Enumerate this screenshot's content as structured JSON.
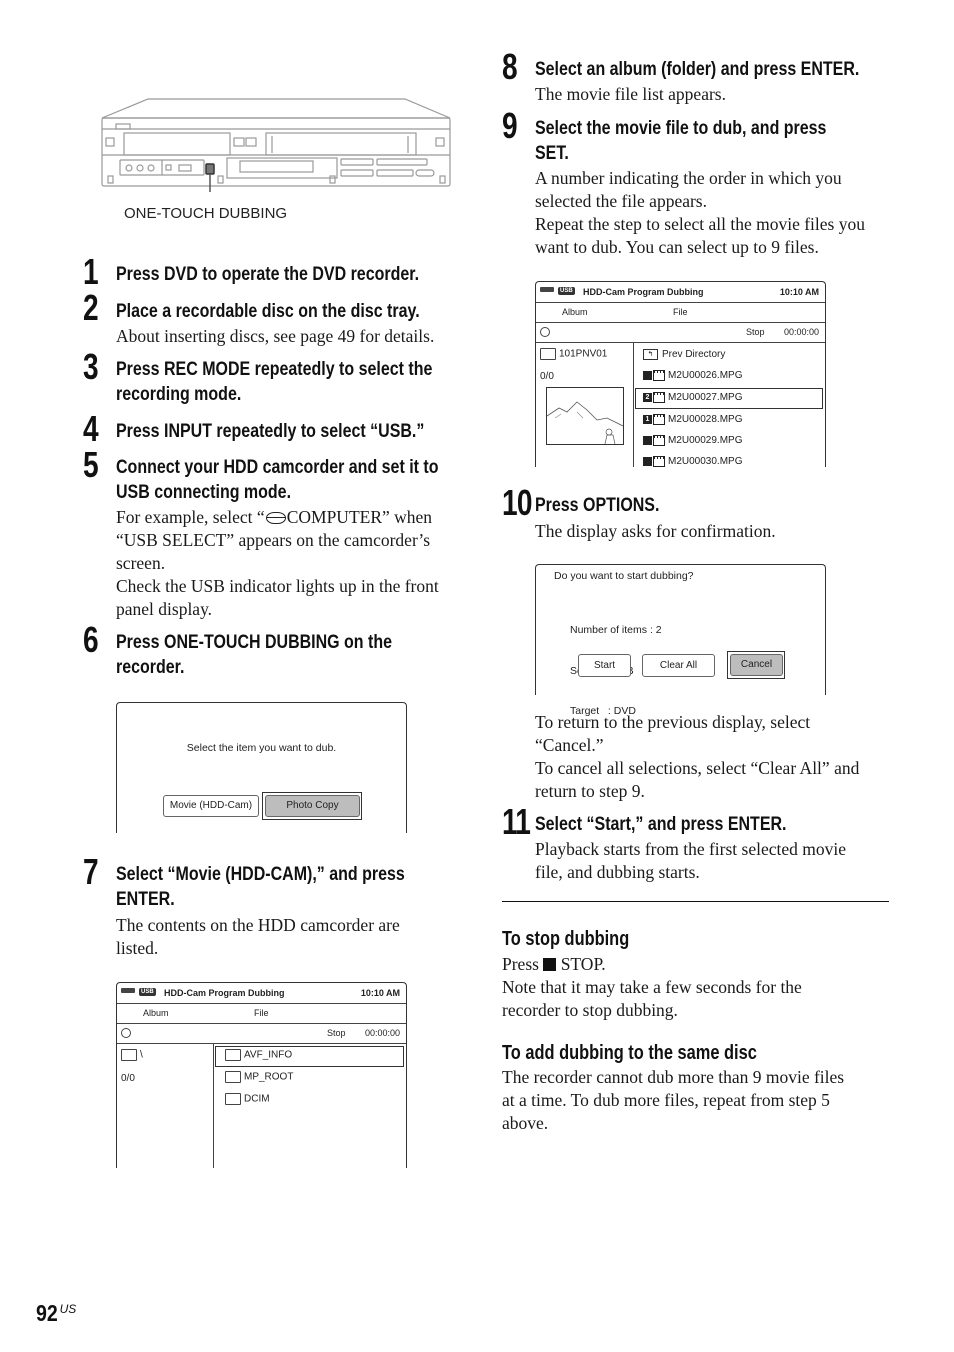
{
  "figure": {
    "callout_label": "ONE-TOUCH DUBBING"
  },
  "steps": [
    {
      "num": "1",
      "heading": [
        "Press DVD to operate the DVD recorder."
      ],
      "body": []
    },
    {
      "num": "2",
      "heading": [
        "Place a recordable disc on the disc tray."
      ],
      "body": [
        "About inserting discs, see page 49 for details."
      ]
    },
    {
      "num": "3",
      "heading": [
        "Press REC MODE repeatedly to select the",
        "recording mode."
      ],
      "body": []
    },
    {
      "num": "4",
      "heading": [
        "Press INPUT repeatedly to select “USB.”"
      ],
      "body": []
    },
    {
      "num": "5",
      "heading": [
        "Connect your HDD camcorder and set it to",
        "USB connecting mode."
      ],
      "body": [
        "For example, select “",
        "COMPUTER” when",
        "“USB SELECT” appears on the camcorder’s",
        "screen.",
        "Check the USB indicator lights up in the front",
        "panel display."
      ]
    },
    {
      "num": "6",
      "heading": [
        "Press ONE-TOUCH DUBBING on the",
        "recorder."
      ],
      "body": []
    },
    {
      "num": "7",
      "heading": [
        "Select “Movie (HDD-CAM),” and press",
        "ENTER."
      ],
      "body": [
        "The contents on the HDD camcorder are",
        "listed."
      ]
    },
    {
      "num": "8",
      "heading": [
        "Select an album (folder) and press ENTER."
      ],
      "body": [
        "The movie file list appears."
      ]
    },
    {
      "num": "9",
      "heading": [
        "Select the movie file to dub, and press",
        "SET."
      ],
      "body": [
        "A number indicating the order in which you",
        "selected the file appears.",
        "Repeat the step to select all the movie files you",
        "want to dub. You can select up to 9 files."
      ]
    },
    {
      "num": "10",
      "heading": [
        "Press OPTIONS."
      ],
      "body": [
        "The display asks for confirmation."
      ]
    },
    {
      "num": "",
      "heading": [],
      "body": [
        "To return to the previous display, select",
        "“Cancel.”",
        "To cancel all selections, select “Clear All” and",
        "return to step 9."
      ]
    },
    {
      "num": "11",
      "heading": [
        "Select “Start,” and press ENTER."
      ],
      "body": [
        "Playback starts from the first selected movie",
        "file, and dubbing starts."
      ]
    }
  ],
  "screen_select": {
    "prompt": "Select the item you want to dub.",
    "buttons": [
      "Movie (HDD-Cam)",
      "Photo Copy"
    ],
    "selected": "Photo Copy"
  },
  "screen_list1": {
    "usb_badge": "USB",
    "title": "HDD-Cam Program Dubbing",
    "time": "10:10 AM",
    "col_album": "Album",
    "col_file": "File",
    "status": "Stop",
    "counter": "00:00:00",
    "album_name": "\\",
    "album_count": "0/0",
    "files": [
      "AVF_INFO",
      "MP_ROOT",
      "DCIM"
    ],
    "selected_index": 0
  },
  "screen_list2": {
    "usb_badge": "USB",
    "title": "HDD-Cam Program Dubbing",
    "time": "10:10 AM",
    "col_album": "Album",
    "col_file": "File",
    "status": "Stop",
    "counter": "00:00:00",
    "album_name": "101PNV01",
    "album_count": "0/0",
    "prev_dir": "Prev Directory",
    "files": [
      {
        "name": "M2U00026.MPG",
        "order": ""
      },
      {
        "name": "M2U00027.MPG",
        "order": "2"
      },
      {
        "name": "M2U00028.MPG",
        "order": "1"
      },
      {
        "name": "M2U00029.MPG",
        "order": ""
      },
      {
        "name": "M2U00030.MPG",
        "order": ""
      }
    ],
    "selected_index": 1
  },
  "screen_confirm": {
    "question": "Do you want to start dubbing?",
    "details": [
      "Number of items : 2",
      "Source : USB",
      "Target   : DVD"
    ],
    "buttons": [
      "Start",
      "Clear All",
      "Cancel"
    ],
    "selected": "Cancel"
  },
  "notes": {
    "stop_heading": "To stop dubbing",
    "stop_body": [
      "Press",
      "STOP.",
      "Note that it may take a few seconds for the",
      "recorder to stop dubbing."
    ],
    "add_heading": "To add dubbing to the same disc",
    "add_body": [
      "The recorder cannot dub more than 9 movie files",
      "at a time. To dub more files, repeat from step 5",
      "above."
    ]
  },
  "footer": {
    "page_number": "92",
    "region": "US"
  }
}
